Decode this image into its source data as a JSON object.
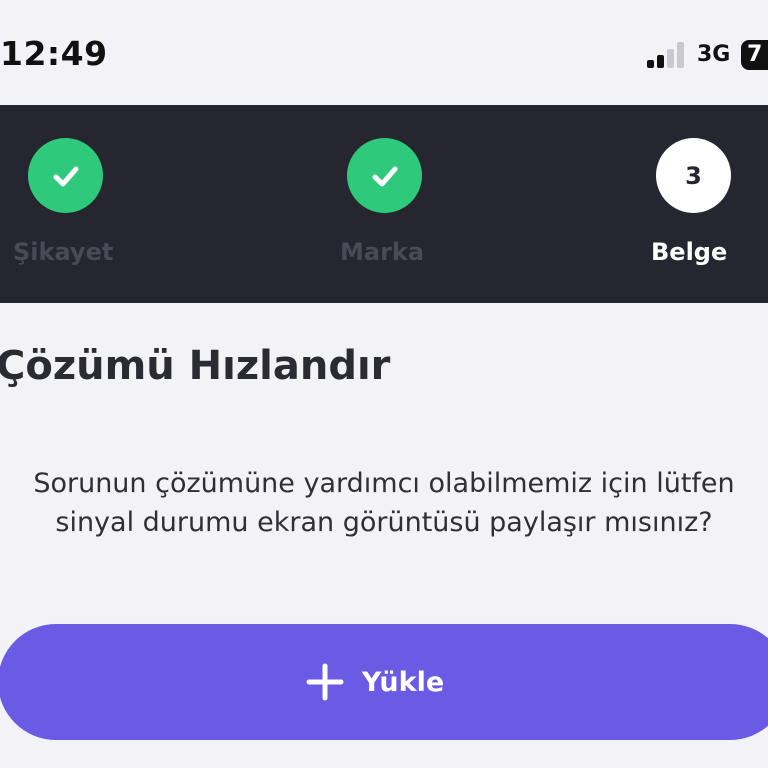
{
  "status_bar": {
    "time": "12:49",
    "network": "3G",
    "battery": "7",
    "signal_bars": 4,
    "signal_bars_active": 2
  },
  "stepper": {
    "steps": [
      {
        "label": "Şikayet",
        "state": "done",
        "icon": "check-icon"
      },
      {
        "label": "Marka",
        "state": "done",
        "icon": "check-icon"
      },
      {
        "label": "Belge",
        "state": "active",
        "number": "3"
      }
    ],
    "colors": {
      "bar": "#262631",
      "done": "#2ec97a",
      "active": "#ffffff"
    }
  },
  "main": {
    "title": "Çözümü Hızlandır",
    "description": "Sorunun çözümüne yardımcı olabilmemiz için lütfen sinyal durumu ekran görüntüsü paylaşır mısınız?",
    "upload_button": {
      "label": "Yükle",
      "icon": "plus-icon",
      "color": "#6a5ae4"
    }
  }
}
